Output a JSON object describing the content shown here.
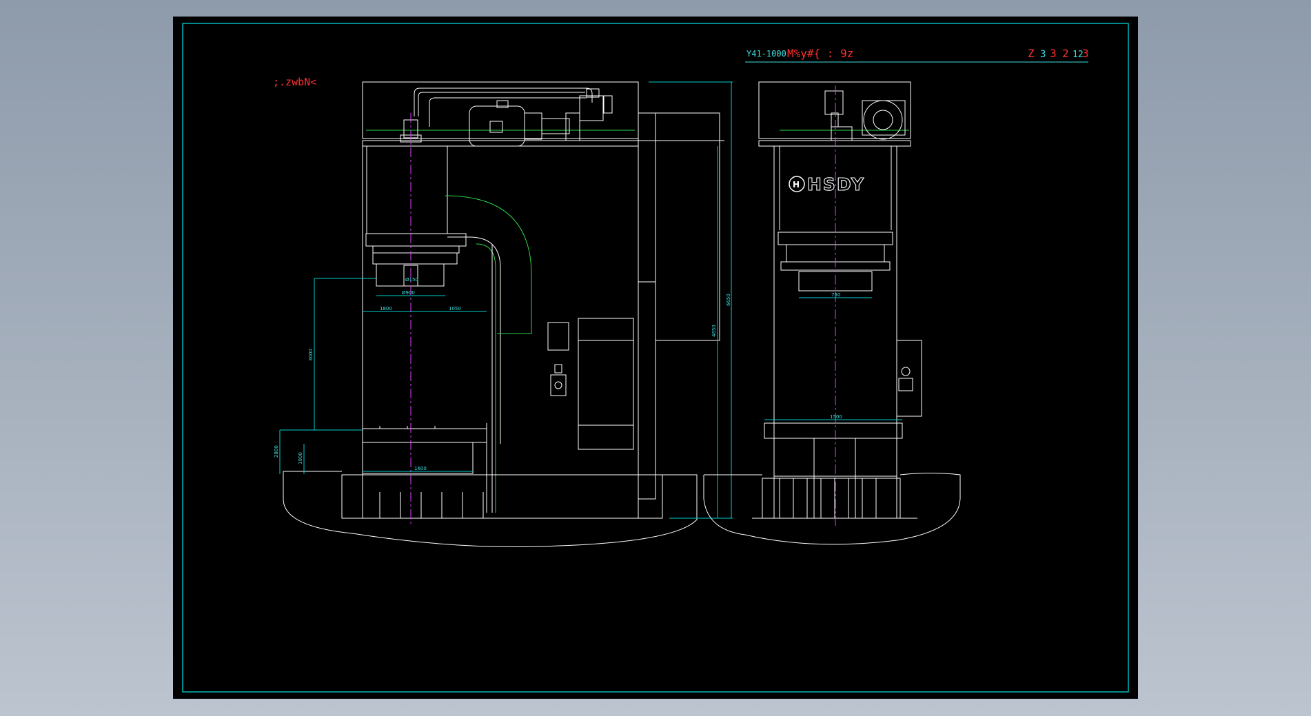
{
  "colors": {
    "background_outer": "#9aa6b4",
    "paper": "#000000",
    "frame": "#00c8c8",
    "line_white": "#ffffff",
    "line_green": "#2bd84a",
    "line_magenta": "#e040ff",
    "line_cyan": "#00d0d0",
    "text_red": "#ff3030",
    "text_cyan": "#40e0e0"
  },
  "title_block": {
    "model": "Y41-1000",
    "garbled_title": "M%y#{ : 9z",
    "drawing_no_a": "Z",
    "drawing_no_b": "3",
    "drawing_no_c": "3",
    "drawing_no_d": "2",
    "drawing_no_e": "12",
    "drawing_no_f": "3"
  },
  "view_label": ";.zwbN<",
  "brand_logo_text": "HSDY",
  "dimensions": {
    "front_overall_height": "6650",
    "front_inner_height": "4650",
    "throat_left": "1800",
    "throat_right": "1050",
    "slide_width": "Ø900",
    "slide_tool": "Ø150",
    "stroke": "3000",
    "table_height": "2800",
    "table_low": "1000",
    "table_width": "1600",
    "side_slide": "750",
    "side_table": "1500"
  }
}
